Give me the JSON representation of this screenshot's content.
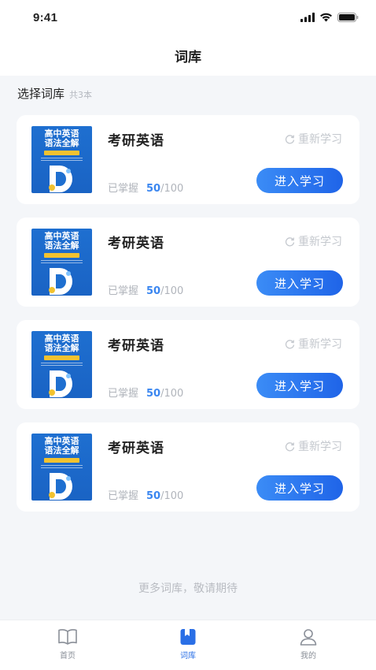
{
  "status_bar": {
    "time": "9:41"
  },
  "nav": {
    "title": "词库"
  },
  "section": {
    "title": "选择词库",
    "count": "共3本"
  },
  "books": [
    {
      "cover_title_1": "高中英语",
      "cover_title_2": "语法全解",
      "name": "考研英语",
      "relearn_label": "重新学习",
      "progress_label": "已掌握",
      "done": "50",
      "total": "/100",
      "button_label": "进入学习"
    },
    {
      "cover_title_1": "高中英语",
      "cover_title_2": "语法全解",
      "name": "考研英语",
      "relearn_label": "重新学习",
      "progress_label": "已掌握",
      "done": "50",
      "total": "/100",
      "button_label": "进入学习"
    },
    {
      "cover_title_1": "高中英语",
      "cover_title_2": "语法全解",
      "name": "考研英语",
      "relearn_label": "重新学习",
      "progress_label": "已掌握",
      "done": "50",
      "total": "/100",
      "button_label": "进入学习"
    },
    {
      "cover_title_1": "高中英语",
      "cover_title_2": "语法全解",
      "name": "考研英语",
      "relearn_label": "重新学习",
      "progress_label": "已掌握",
      "done": "50",
      "total": "/100",
      "button_label": "进入学习"
    }
  ],
  "footer_note": "更多词库，敬请期待",
  "tabbar": {
    "items": [
      {
        "label": "首页",
        "icon": "book-open-icon"
      },
      {
        "label": "词库",
        "icon": "bookmark-book-icon"
      },
      {
        "label": "我的",
        "icon": "user-icon"
      }
    ],
    "active_index": 1
  },
  "colors": {
    "accent": "#2a6fe6",
    "button_start": "#3b8cf6",
    "button_end": "#1f64e8",
    "background": "#f4f6f9"
  }
}
